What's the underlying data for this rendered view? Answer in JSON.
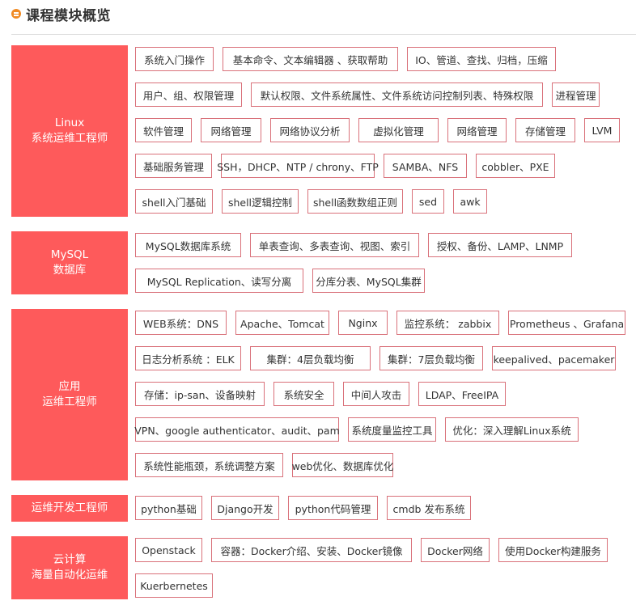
{
  "header": {
    "title": "课程模块概览",
    "icon": "menu-circle-icon",
    "icon_color": "#f08a24"
  },
  "colors": {
    "accent": "#fe5a5b",
    "tag_border": "#d9717a"
  },
  "modules": [
    {
      "title_lines": [
        "Linux",
        "系统运维工程师"
      ],
      "tags": [
        "系统入门操作",
        "基本命令、文本编辑器 、获取帮助",
        "IO、管道、查找、归档，压缩",
        "用户、组、权限管理",
        "默认权限、文件系统属性、文件系统访问控制列表、特殊权限",
        "进程管理",
        "软件管理",
        "网络管理",
        "网络协议分析",
        "虚拟化管理",
        "网络管理",
        "存储管理",
        "LVM",
        "基础服务管理",
        "SSH，DHCP、NTP / chrony、FTP",
        "SAMBA、NFS",
        "cobbler、PXE",
        "shell入门基础",
        "shell逻辑控制",
        "shell函数数组正则",
        "sed",
        "awk"
      ]
    },
    {
      "title_lines": [
        "MySQL",
        "数据库"
      ],
      "tags": [
        "MySQL数据库系统",
        "单表查询、多表查询、视图、索引",
        "授权、备份、LAMP、LNMP",
        "MySQL Replication、读写分离",
        "分库分表、MySQL集群"
      ]
    },
    {
      "title_lines": [
        "应用",
        "运维工程师"
      ],
      "tags": [
        "WEB系统：DNS",
        "Apache、Tomcat",
        "Nginx",
        "监控系统： zabbix",
        "Prometheus 、Grafana",
        "日志分析系统 ：ELK",
        "集群：4层负载均衡",
        "集群：7层负载均衡",
        "keepalived、pacemaker",
        "存储：ip-san、设备映射",
        "系统安全",
        "中间人攻击",
        "LDAP、FreeIPA",
        "VPN、google authenticator、audit、pam",
        "系统度量监控工具",
        "优化：深入理解Linux系统",
        "系统性能瓶颈，系统调整方案",
        "web优化、数据库优化"
      ]
    },
    {
      "title_lines": [
        "运维开发工程师"
      ],
      "tags": [
        "python基础",
        "Django开发",
        "python代码管理",
        "cmdb 发布系统"
      ]
    },
    {
      "title_lines": [
        "云计算",
        "海量自动化运维"
      ],
      "tags": [
        "Openstack",
        "容器：Docker介绍、安装、Docker镜像",
        "Docker网络",
        "使用Docker构建服务",
        "Kuerbernetes"
      ]
    }
  ]
}
